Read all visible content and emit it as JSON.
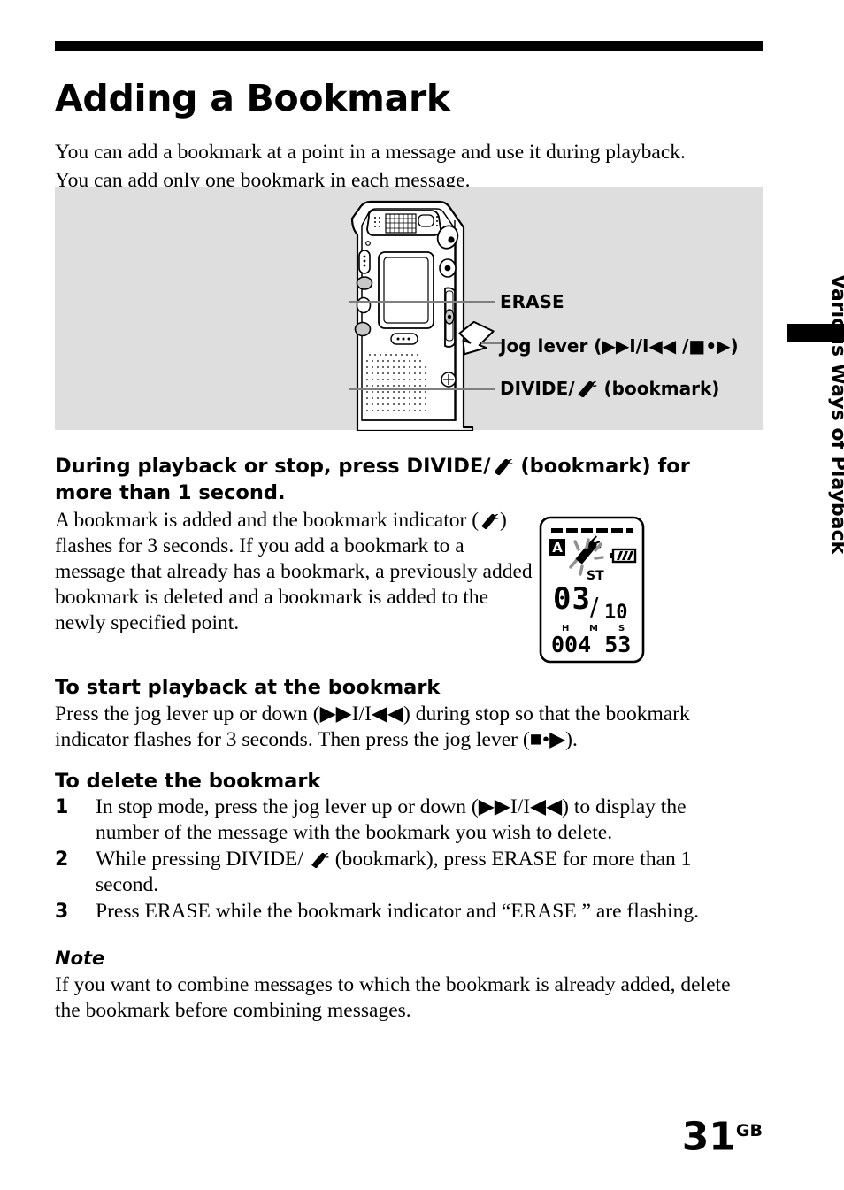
{
  "page": {
    "title": "Adding a Bookmark",
    "intro": "You can add a bookmark at a point in a message and use it during playback.  You can add only one bookmark in each message.",
    "number": "31",
    "number_suffix": "GB",
    "side_tab": "Various Ways of Playback"
  },
  "figure": {
    "callouts": {
      "erase": "ERASE",
      "jog_lever": "Jog lever (▶▶I/I◀◀ /■•▶)",
      "divide_prefix": "DIVIDE/",
      "divide_suffix": "(bookmark)"
    }
  },
  "step": {
    "heading_part1": "During playback or stop, press DIVIDE/",
    "heading_part2": "(bookmark) for more than 1 second.",
    "body_line1_a": "A bookmark is added and the bookmark indicator (",
    "body_line1_b": ") flashes for 3 seconds.",
    "body_line2": "If you add a bookmark to a message that already has a bookmark, a previously added bookmark is deleted and a bookmark is added to the newly specified point."
  },
  "lcd": {
    "alarm_badge": "A",
    "stereo_label": "ST",
    "message_current": "03",
    "message_separator": "/",
    "message_total": "10",
    "time_hours": "00",
    "time_minutes": "4",
    "time_seconds": "53",
    "hour_unit": "H",
    "minute_unit": "M",
    "second_unit": "S"
  },
  "sections": {
    "start_playback": {
      "heading": "To start playback at the bookmark",
      "body": "Press the jog lever up or down (▶▶I/I◀◀) during stop so that the bookmark indicator flashes for 3 seconds.  Then press the jog lever (■•▶)."
    },
    "delete_bookmark": {
      "heading": "To delete the bookmark",
      "steps": [
        {
          "number": "1",
          "text": "In stop mode, press the jog lever up or down (▶▶I/I◀◀) to display the number of the message with the bookmark you wish to delete."
        },
        {
          "number": "2",
          "text_before": "While pressing DIVIDE/",
          "text_after": "(bookmark), press ERASE for more than 1 second."
        },
        {
          "number": "3",
          "text": "Press ERASE while the bookmark indicator and “ERASE ” are flashing."
        }
      ]
    }
  },
  "note": {
    "heading": "Note",
    "body": "If you want to combine messages to which the bookmark is already added, delete the bookmark before combining messages."
  },
  "colors": {
    "panel_background": "#dedede",
    "rule": "#000000",
    "leader_line": "#808080"
  }
}
